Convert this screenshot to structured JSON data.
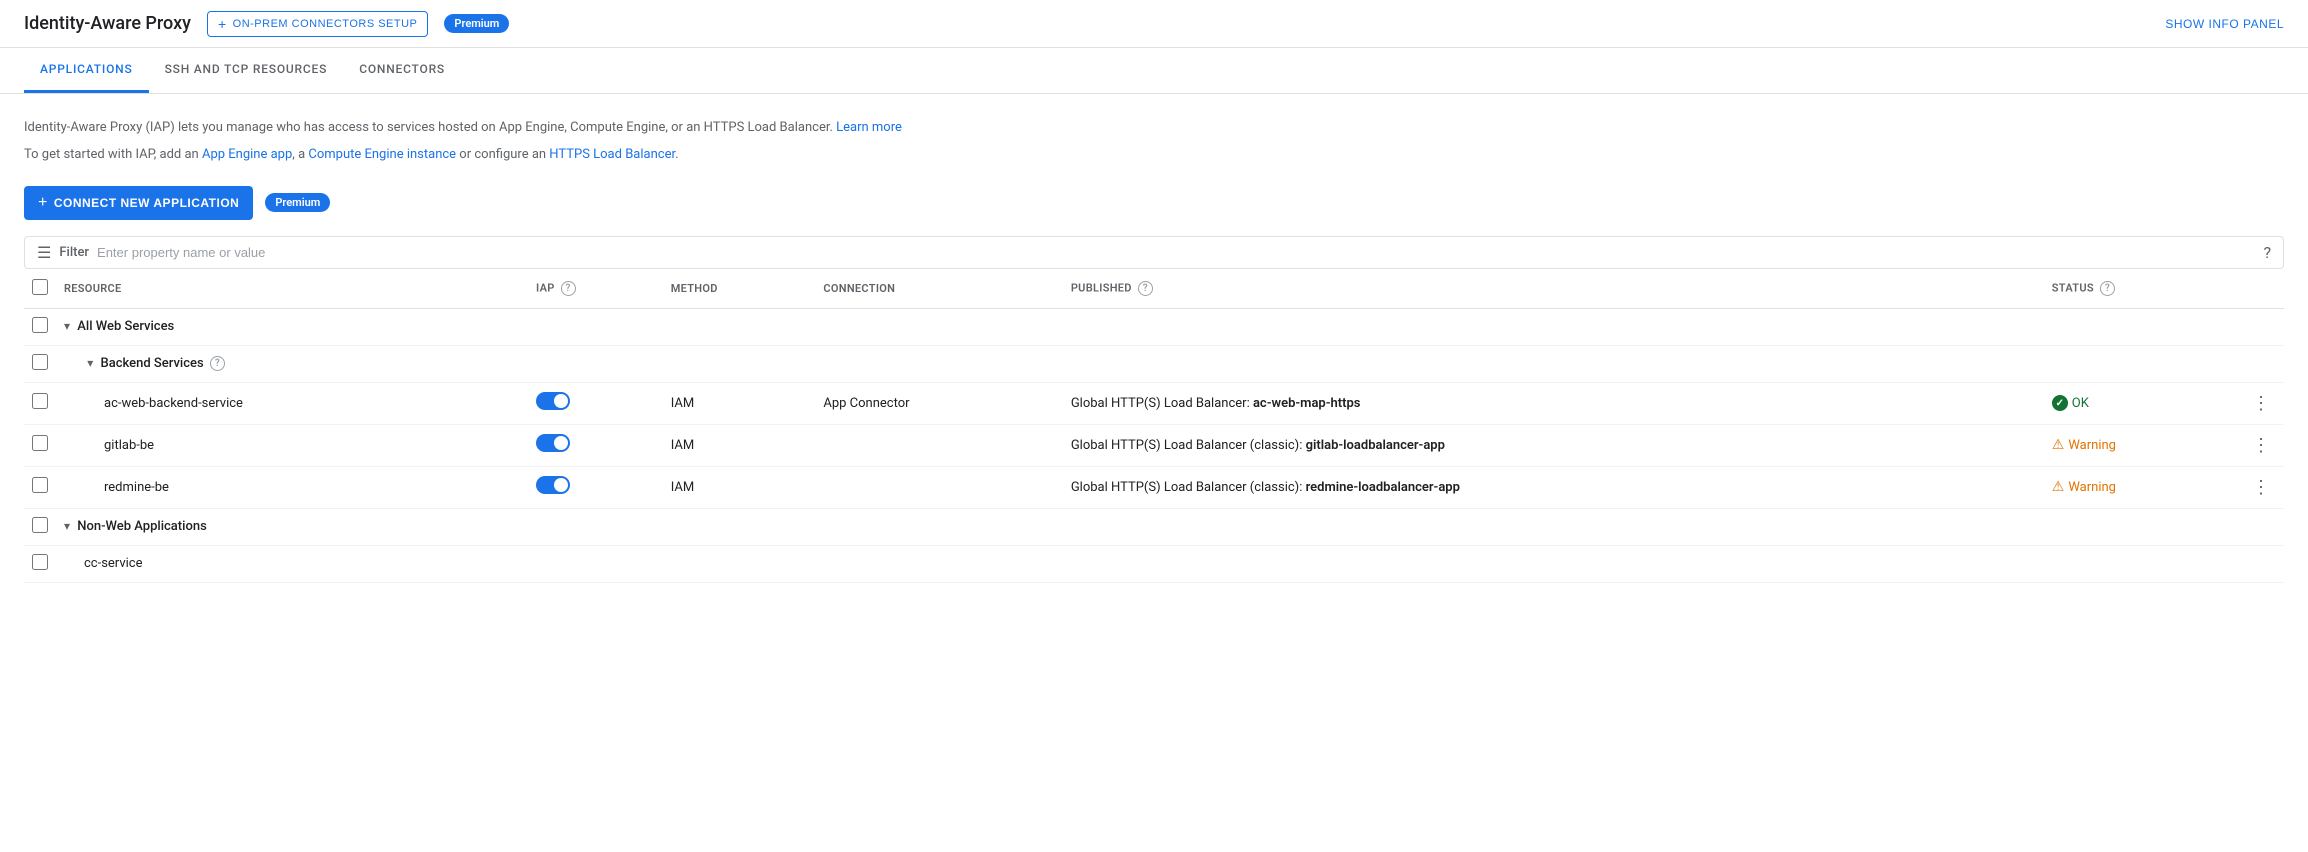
{
  "header": {
    "title": "Identity-Aware Proxy",
    "on_prem_label": "ON-PREM CONNECTORS SETUP",
    "premium_label": "Premium",
    "show_info_label": "SHOW INFO PANEL"
  },
  "tabs": [
    {
      "id": "applications",
      "label": "APPLICATIONS",
      "active": true
    },
    {
      "id": "ssh-tcp",
      "label": "SSH AND TCP RESOURCES",
      "active": false
    },
    {
      "id": "connectors",
      "label": "CONNECTORS",
      "active": false
    }
  ],
  "info": {
    "line1": "Identity-Aware Proxy (IAP) lets you manage who has access to services hosted on App Engine, Compute Engine, or an HTTPS Load Balancer.",
    "learn_more": "Learn more",
    "line2_prefix": "To get started with IAP, add an",
    "app_engine_link": "App Engine app",
    "line2_mid1": ", a",
    "compute_engine_link": "Compute Engine instance",
    "line2_mid2": "or configure an",
    "https_lb_link": "HTTPS Load Balancer",
    "line2_suffix": "."
  },
  "actions": {
    "connect_label": "CONNECT NEW APPLICATION",
    "premium_label": "Premium"
  },
  "filter": {
    "label": "Filter",
    "placeholder": "Enter property name or value"
  },
  "table": {
    "columns": [
      {
        "id": "resource",
        "label": "Resource"
      },
      {
        "id": "iap",
        "label": "IAP",
        "has_help": true
      },
      {
        "id": "method",
        "label": "Method"
      },
      {
        "id": "connection",
        "label": "Connection"
      },
      {
        "id": "published",
        "label": "Published",
        "has_help": true
      },
      {
        "id": "status",
        "label": "Status",
        "has_help": true
      }
    ],
    "groups": [
      {
        "id": "all-web-services",
        "label": "All Web Services",
        "expanded": true,
        "subgroups": [
          {
            "id": "backend-services",
            "label": "Backend Services",
            "has_help": true,
            "expanded": true,
            "rows": [
              {
                "id": "ac-web-backend-service",
                "resource": "ac-web-backend-service",
                "iap_on": true,
                "method": "IAM",
                "connection": "App Connector",
                "published_prefix": "Global HTTP(S) Load Balancer: ",
                "published_bold": "ac-web-map-https",
                "status": "OK",
                "status_type": "ok"
              },
              {
                "id": "gitlab-be",
                "resource": "gitlab-be",
                "iap_on": true,
                "method": "IAM",
                "connection": "",
                "published_prefix": "Global HTTP(S) Load Balancer (classic): ",
                "published_bold": "gitlab-loadbalancer-app",
                "status": "Warning",
                "status_type": "warning"
              },
              {
                "id": "redmine-be",
                "resource": "redmine-be",
                "iap_on": true,
                "method": "IAM",
                "connection": "",
                "published_prefix": "Global HTTP(S) Load Balancer (classic): ",
                "published_bold": "redmine-loadbalancer-app",
                "status": "Warning",
                "status_type": "warning"
              }
            ]
          }
        ]
      },
      {
        "id": "non-web-applications",
        "label": "Non-Web Applications",
        "expanded": true,
        "rows": [
          {
            "id": "cc-service",
            "resource": "cc-service",
            "iap_on": false,
            "method": "",
            "connection": "",
            "published_prefix": "",
            "published_bold": "",
            "status": "",
            "status_type": ""
          }
        ]
      }
    ]
  }
}
